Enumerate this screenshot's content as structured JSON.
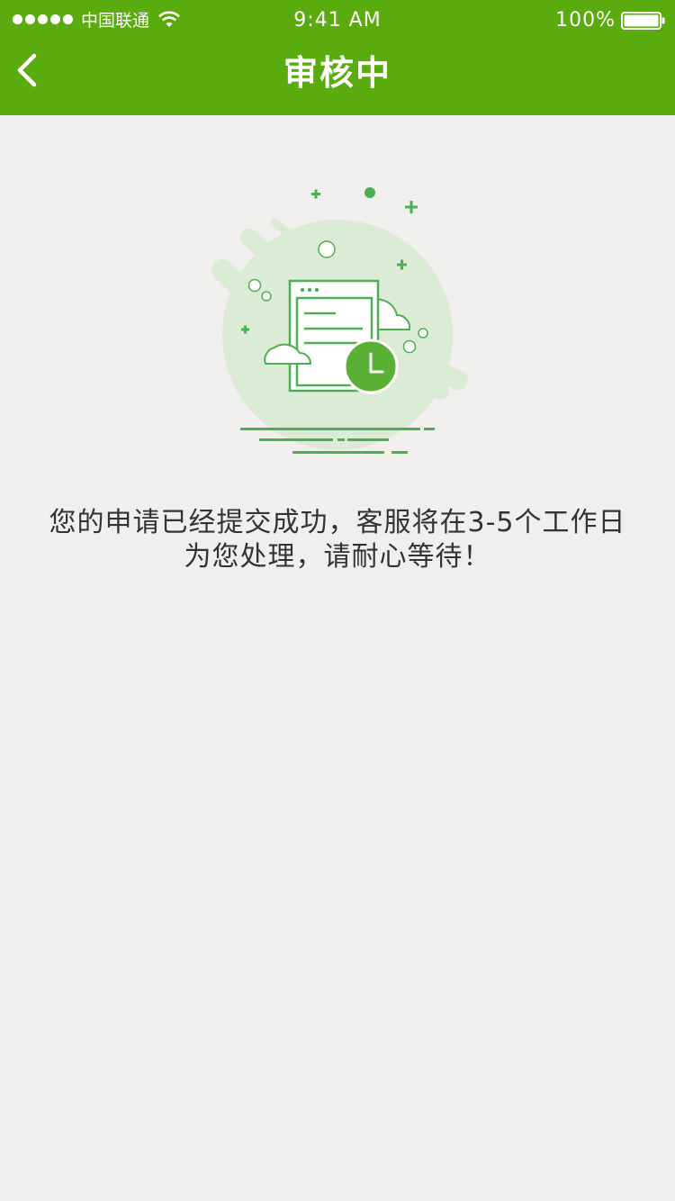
{
  "status_bar": {
    "carrier": "中国联通",
    "time": "9:41 AM",
    "battery": "100%",
    "icons": [
      "signal-dots-icon",
      "wifi-icon",
      "battery-icon"
    ]
  },
  "nav": {
    "title": "审核中",
    "back_icon": "chevron-left-icon"
  },
  "content": {
    "illustration_icon": "document-pending-review-icon",
    "message_line1": "您的申请已经提交成功，客服将在3-5个工作日",
    "message_line2": "为您处理，请耐心等待！"
  },
  "colors": {
    "brand_green": "#5aab0d",
    "illustration_green": "#4caf50",
    "light_green": "#dcebd6",
    "background": "#f0efee",
    "text": "#333333"
  }
}
